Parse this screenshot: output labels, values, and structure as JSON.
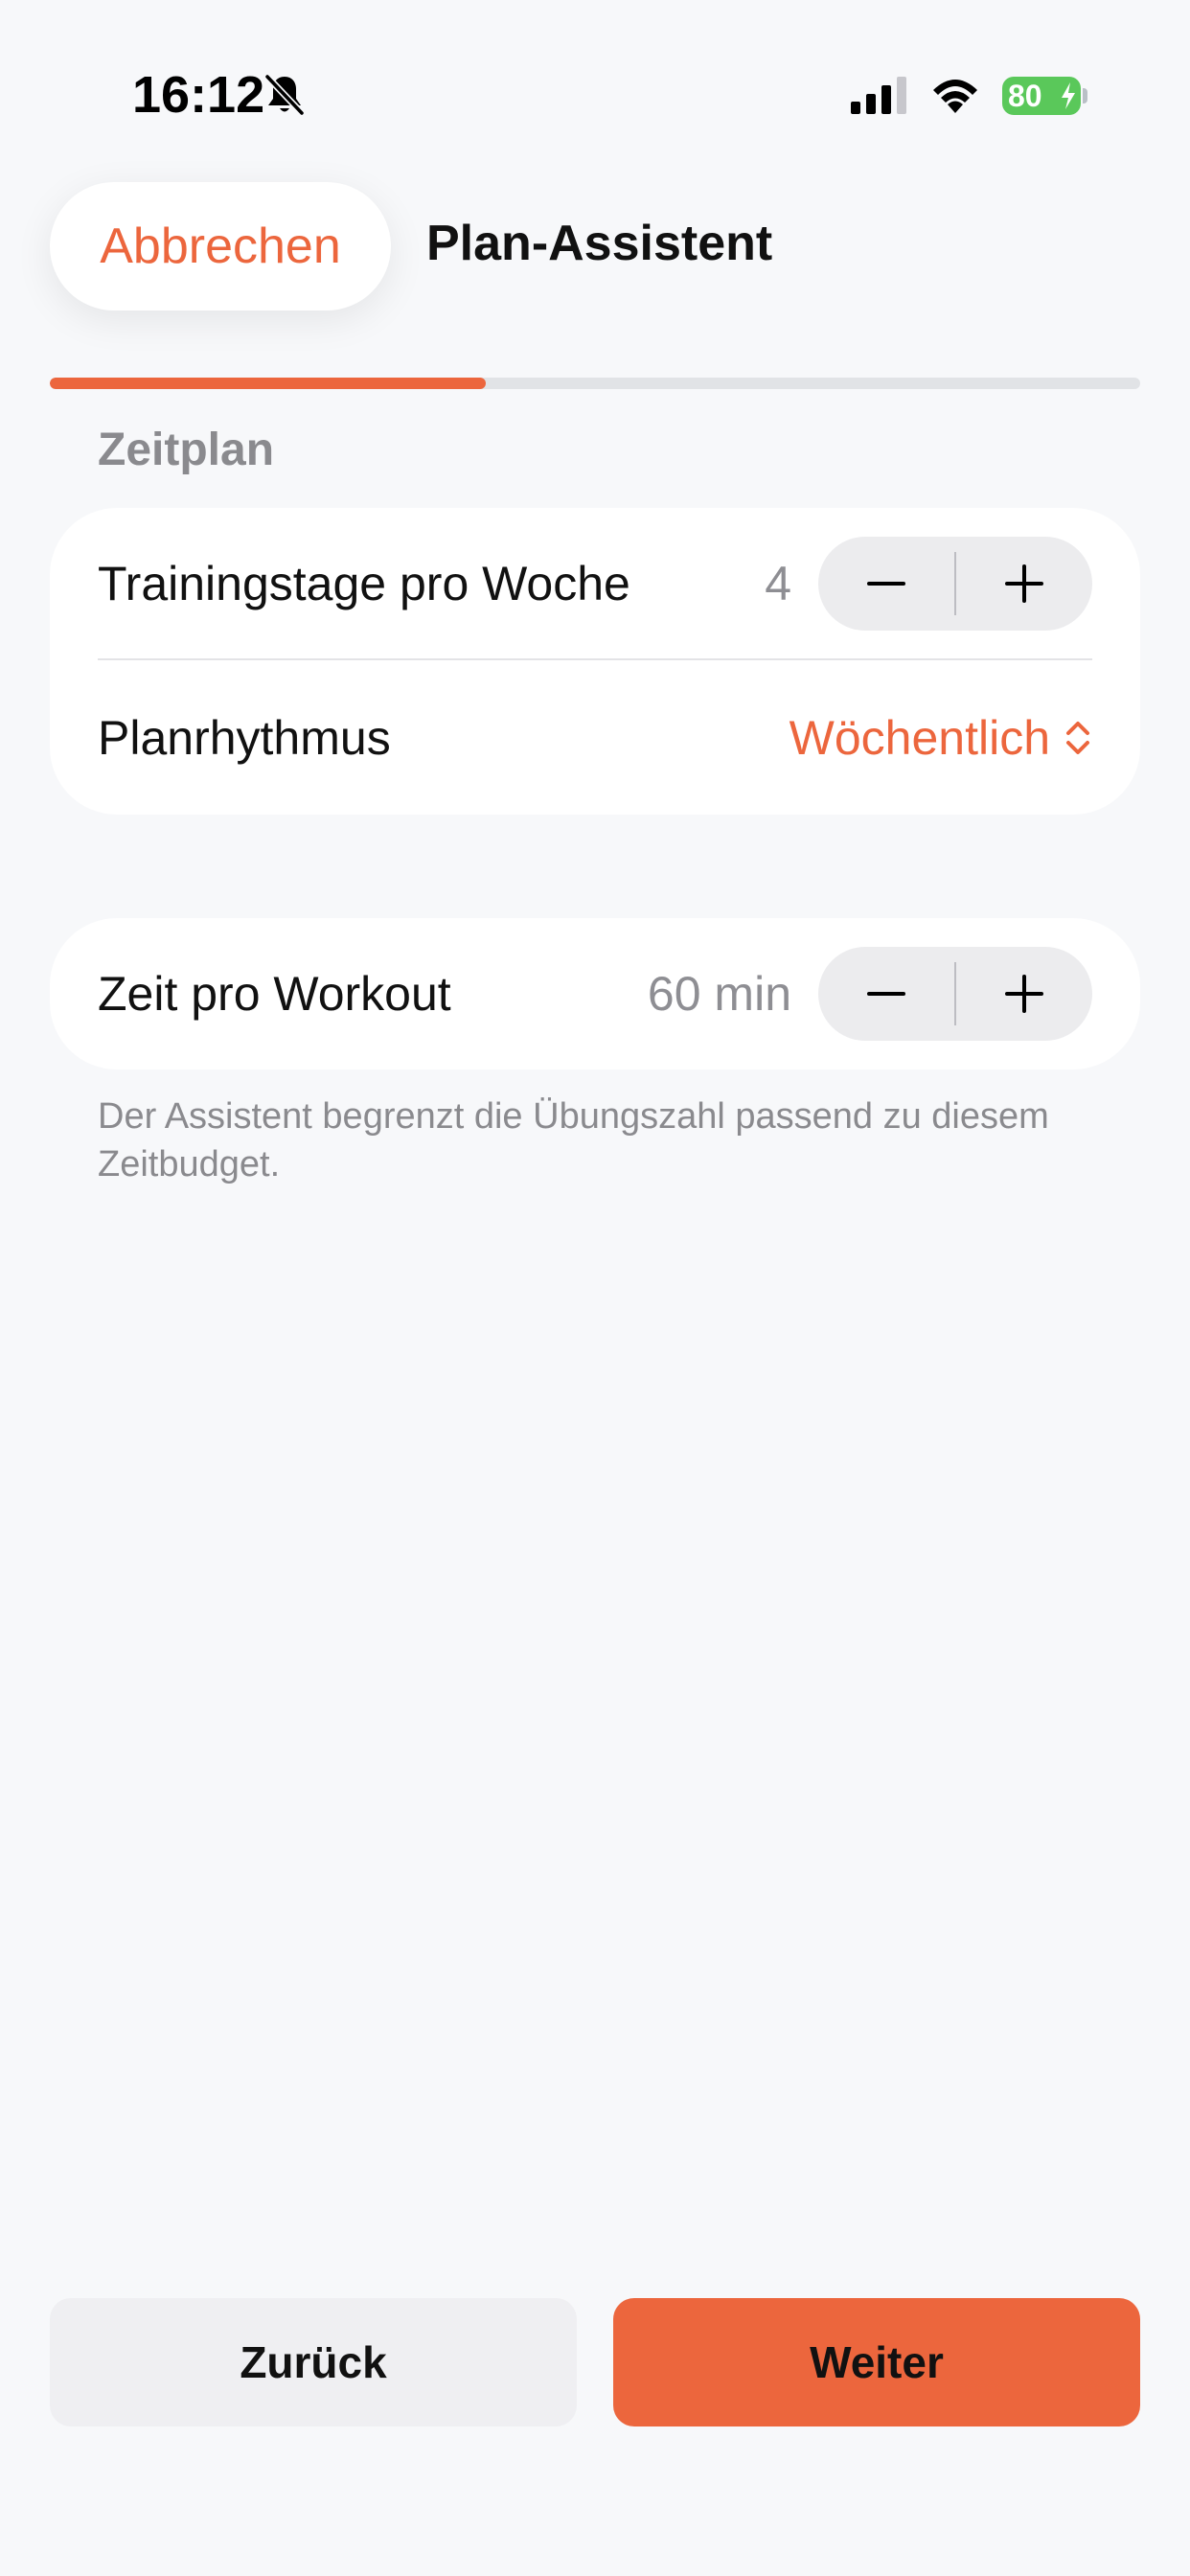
{
  "status_bar": {
    "time": "16:12",
    "battery": "80",
    "silent_mode": true
  },
  "header": {
    "cancel_label": "Abbrechen",
    "title": "Plan-Assistent"
  },
  "progress": {
    "fraction": 0.4
  },
  "section": {
    "label": "Zeitplan"
  },
  "schedule": {
    "training_days": {
      "label": "Trainingstage pro Woche",
      "value": "4"
    },
    "rhythm": {
      "label": "Planrhythmus",
      "value": "Wöchentlich"
    }
  },
  "workout_time": {
    "label": "Zeit pro Workout",
    "value": "60 min",
    "hint": "Der Assistent begrenzt die Übungszahl passend zu diesem Zeitbudget."
  },
  "footer": {
    "back_label": "Zurück",
    "next_label": "Weiter"
  },
  "colors": {
    "accent": "#ec663d",
    "background": "#f7f8fa",
    "battery": "#5ac85a"
  },
  "icons": {
    "silent": "bell-slash-icon",
    "signal": "cellular-signal-icon",
    "wifi": "wifi-icon",
    "battery": "battery-charging-icon",
    "minus": "minus-icon",
    "plus": "plus-icon",
    "picker": "chevron-up-down-icon"
  }
}
